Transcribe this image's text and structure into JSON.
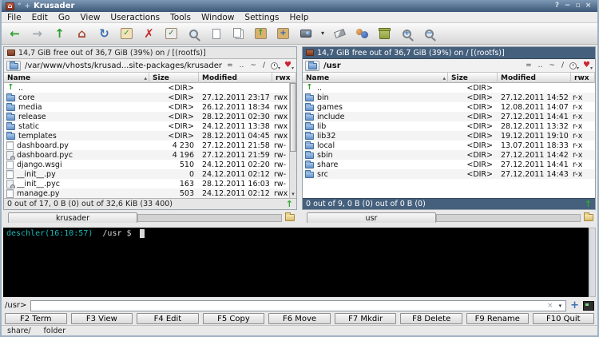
{
  "window": {
    "title": "Krusader",
    "pin_glyph": "°",
    "ontop_glyph": "+",
    "app_glyph": "⌂",
    "controls": [
      {
        "name": "help",
        "glyph": "?"
      },
      {
        "name": "minimize",
        "glyph": "−"
      },
      {
        "name": "maximize",
        "glyph": "▫"
      },
      {
        "name": "close",
        "glyph": "×"
      }
    ]
  },
  "menu": {
    "items": [
      "File",
      "Edit",
      "Go",
      "View",
      "Useractions",
      "Tools",
      "Window",
      "Settings",
      "Help"
    ]
  },
  "toolbar": {
    "items": [
      {
        "name": "back-icon",
        "kind": "glyph",
        "glyph": "←",
        "color": "#2f9e2f"
      },
      {
        "name": "forward-icon",
        "kind": "glyph",
        "glyph": "→",
        "color": "#a0a6ac"
      },
      {
        "name": "up-icon",
        "kind": "glyph",
        "glyph": "↑",
        "color": "#2f9e2f"
      },
      {
        "name": "home-icon",
        "kind": "glyph",
        "glyph": "⌂",
        "color": "#a84632"
      },
      {
        "name": "reload-icon",
        "kind": "glyph",
        "glyph": "↻",
        "color": "#3a6fb0"
      },
      {
        "name": "select-group-icon",
        "kind": "chip",
        "glyph": "✓",
        "color": "#2f9e2f",
        "bg": "#f2e2b8"
      },
      {
        "name": "unselect-group-icon",
        "kind": "glyph",
        "glyph": "✗",
        "color": "#c92a2a"
      },
      {
        "name": "invert-selection-icon",
        "kind": "chip",
        "glyph": "✓",
        "color": "#3d7a2f",
        "bg": "#ececec"
      },
      {
        "name": "search-icon",
        "kind": "mag",
        "glyph": ""
      },
      {
        "name": "view-file-icon",
        "kind": "page"
      },
      {
        "name": "copy-icon",
        "kind": "pages"
      },
      {
        "name": "pack-icon",
        "kind": "chip",
        "glyph": "↑",
        "color": "#2f9e2f",
        "bg": "#d8b26d"
      },
      {
        "name": "unpack-icon",
        "kind": "chip",
        "glyph": "+",
        "color": "#2f5fae",
        "bg": "#d8b26d"
      },
      {
        "name": "mount-manager-icon",
        "kind": "disk"
      },
      {
        "name": "toolbar-overflow-icon",
        "kind": "glyph",
        "glyph": "▾",
        "color": "#333",
        "small": true
      },
      {
        "name": "eraser-icon",
        "kind": "eraser"
      },
      {
        "name": "useractions-icon",
        "kind": "users"
      },
      {
        "name": "trash-icon",
        "kind": "trash"
      },
      {
        "name": "zoom-in-icon",
        "kind": "mag",
        "glyph": "+"
      },
      {
        "name": "zoom-out-icon",
        "kind": "mag",
        "glyph": "−"
      }
    ]
  },
  "glyphs": {
    "up_arrow": "↑",
    "sort": "▴",
    "dropdown": "▾",
    "clear": "×",
    "heart": "♥"
  },
  "panels": {
    "left": {
      "free_space": "14,7 GiB free out of 36,7 GiB (39%) on / [(rootfs)]",
      "path": "/var/www/vhosts/krusad...site-packages/krusader",
      "toolbar_buttons": [
        "=",
        "..",
        "~",
        "/"
      ],
      "columns": [
        "Name",
        "Size",
        "Modified",
        "rwx"
      ],
      "rows": [
        {
          "icon": "up",
          "name": "..",
          "size": "<DIR>",
          "modified": "",
          "perm": ""
        },
        {
          "icon": "folder",
          "name": "core",
          "size": "<DIR>",
          "modified": "27.12.2011 23:17",
          "perm": "rwx"
        },
        {
          "icon": "folder",
          "name": "media",
          "size": "<DIR>",
          "modified": "26.12.2011 18:34",
          "perm": "rwx"
        },
        {
          "icon": "folder",
          "name": "release",
          "size": "<DIR>",
          "modified": "28.12.2011 02:30",
          "perm": "rwx"
        },
        {
          "icon": "folder",
          "name": "static",
          "size": "<DIR>",
          "modified": "24.12.2011 13:38",
          "perm": "rwx"
        },
        {
          "icon": "folder",
          "name": "templates",
          "size": "<DIR>",
          "modified": "28.12.2011 04:45",
          "perm": "rwx"
        },
        {
          "icon": "file",
          "name": "dashboard.py",
          "size": "4 230",
          "modified": "27.12.2011 21:58",
          "perm": "rw-"
        },
        {
          "icon": "filec",
          "name": "dashboard.pyc",
          "size": "4 196",
          "modified": "27.12.2011 21:59",
          "perm": "rw-"
        },
        {
          "icon": "file",
          "name": "django.wsgi",
          "size": "510",
          "modified": "24.12.2011 02:20",
          "perm": "rw-"
        },
        {
          "icon": "file",
          "name": "__init__.py",
          "size": "0",
          "modified": "24.12.2011 02:12",
          "perm": "rw-"
        },
        {
          "icon": "filec",
          "name": "__init__.pyc",
          "size": "163",
          "modified": "28.12.2011 16:03",
          "perm": "rw-"
        },
        {
          "icon": "file",
          "name": "manage.py",
          "size": "503",
          "modified": "24.12.2011 02:12",
          "perm": "rwx"
        }
      ],
      "status": "0 out of 17, 0 B (0) out of 32,6 KiB (33 400)",
      "tab": "krusader"
    },
    "right": {
      "free_space": "14,7 GiB free out of 36,7 GiB (39%) on / [(rootfs)]",
      "path": "/usr",
      "toolbar_buttons": [
        "=",
        "..",
        "~",
        "/"
      ],
      "columns": [
        "Name",
        "Size",
        "Modified",
        "rwx"
      ],
      "rows": [
        {
          "icon": "up",
          "name": "..",
          "size": "<DIR>",
          "modified": "",
          "perm": ""
        },
        {
          "icon": "folder",
          "name": "bin",
          "size": "<DIR>",
          "modified": "27.12.2011 14:52",
          "perm": "r-x"
        },
        {
          "icon": "folder",
          "name": "games",
          "size": "<DIR>",
          "modified": "12.08.2011 14:07",
          "perm": "r-x"
        },
        {
          "icon": "folder",
          "name": "include",
          "size": "<DIR>",
          "modified": "27.12.2011 14:41",
          "perm": "r-x"
        },
        {
          "icon": "folder",
          "name": "lib",
          "size": "<DIR>",
          "modified": "28.12.2011 13:32",
          "perm": "r-x"
        },
        {
          "icon": "folder",
          "name": "lib32",
          "size": "<DIR>",
          "modified": "19.12.2011 19:10",
          "perm": "r-x"
        },
        {
          "icon": "folder",
          "name": "local",
          "size": "<DIR>",
          "modified": "13.07.2011 18:33",
          "perm": "r-x"
        },
        {
          "icon": "folder",
          "name": "sbin",
          "size": "<DIR>",
          "modified": "27.12.2011 14:42",
          "perm": "r-x"
        },
        {
          "icon": "folder",
          "name": "share",
          "size": "<DIR>",
          "modified": "27.12.2011 14:41",
          "perm": "r-x"
        },
        {
          "icon": "folder",
          "name": "src",
          "size": "<DIR>",
          "modified": "27.12.2011 14:43",
          "perm": "r-x"
        }
      ],
      "status": "0 out of 9, 0 B (0) out of 0 B (0)",
      "tab": "usr"
    }
  },
  "terminal": {
    "prompt_host": "deschler(16:10:57)",
    "prompt_path": "/usr $"
  },
  "cmdline": {
    "label": "/usr>",
    "value": ""
  },
  "fkeys": [
    "F2 Term",
    "F3 View",
    "F4 Edit",
    "F5 Copy",
    "F6 Move",
    "F7 Mkdir",
    "F8 Delete",
    "F9 Rename",
    "F10 Quit"
  ],
  "statusbar": {
    "items": [
      "share/",
      "folder"
    ]
  },
  "colors": {
    "active_panel": "#45607d",
    "terminal_prompt": "#1cb8b8",
    "titlebar": "#3c5878",
    "folder_icon": "#6492c8"
  }
}
